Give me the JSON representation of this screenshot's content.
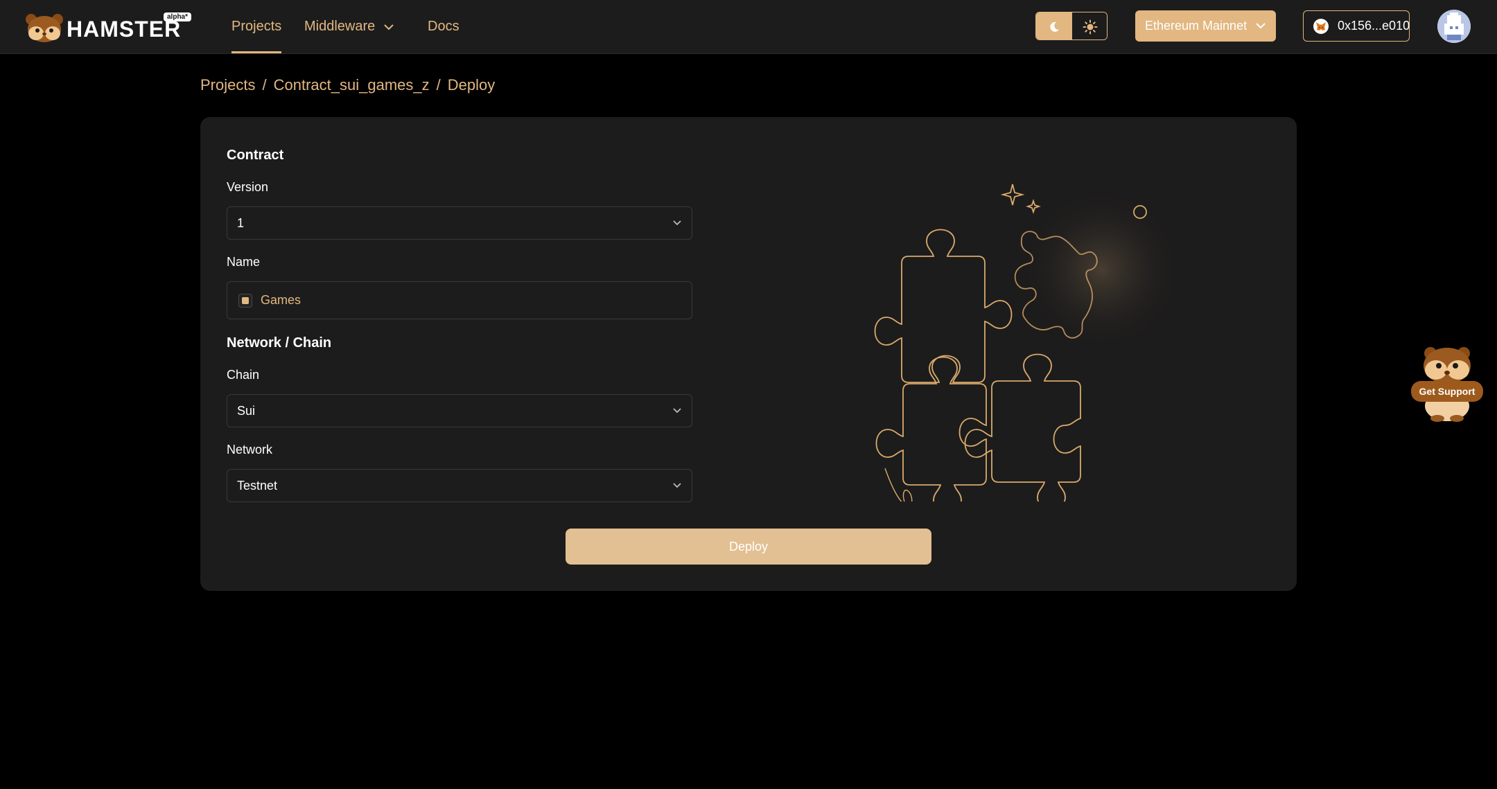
{
  "brand": {
    "name": "HAMSTER",
    "badge": "alpha*"
  },
  "nav": {
    "projects": "Projects",
    "middleware": "Middleware",
    "docs": "Docs"
  },
  "network": {
    "selected": "Ethereum Mainnet"
  },
  "wallet": {
    "address": "0x156...e010"
  },
  "breadcrumb": {
    "items": [
      "Projects",
      "Contract_sui_games_z",
      "Deploy"
    ],
    "separator": "/"
  },
  "form": {
    "contract_section": "Contract",
    "version_label": "Version",
    "version_value": "1",
    "name_label": "Name",
    "name_value": "Games",
    "network_section": "Network / Chain",
    "chain_label": "Chain",
    "chain_value": "Sui",
    "network_label": "Network",
    "network_value": "Testnet",
    "deploy_button": "Deploy"
  },
  "support": {
    "label": "Get Support"
  },
  "colors": {
    "accent": "#e2b781",
    "background": "#000000",
    "topbar": "#1c1c1c",
    "card": "#1d1c1c",
    "deploy_button": "#e2c093"
  }
}
